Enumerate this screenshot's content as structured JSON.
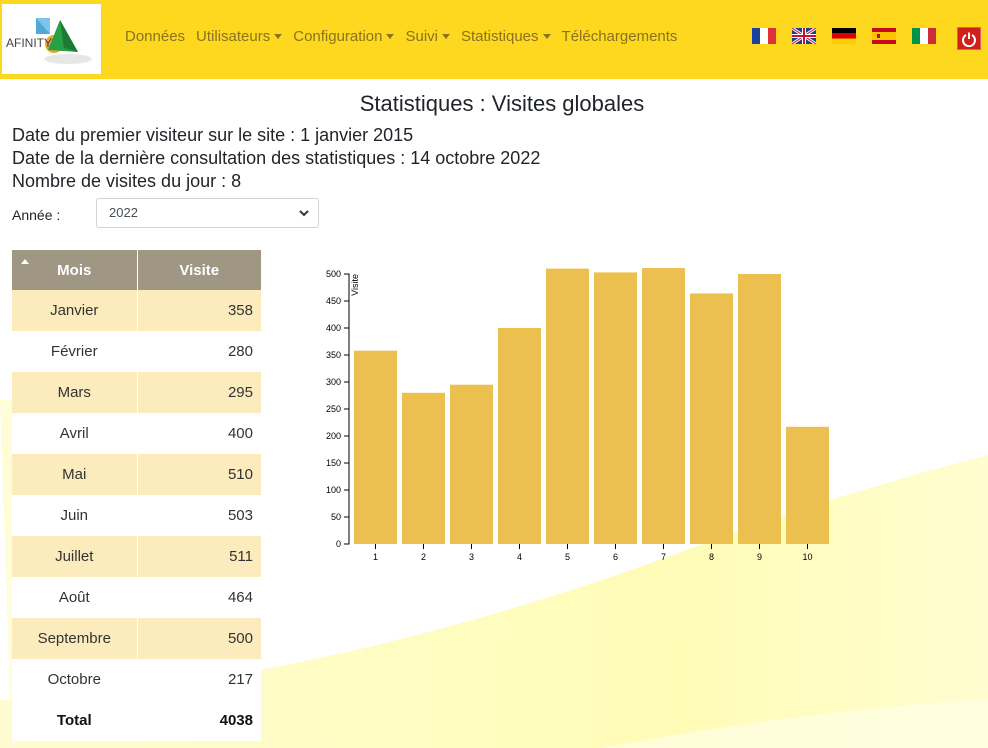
{
  "navbar": {
    "logo_text": "AFINITY",
    "items": [
      {
        "label": "Données",
        "dropdown": false
      },
      {
        "label": "Utilisateurs",
        "dropdown": true
      },
      {
        "label": "Configuration",
        "dropdown": true
      },
      {
        "label": "Suivi",
        "dropdown": true
      },
      {
        "label": "Statistiques",
        "dropdown": true
      },
      {
        "label": "Téléchargements",
        "dropdown": false
      }
    ],
    "flags": [
      "fr-flag-icon",
      "gb-flag-icon",
      "de-flag-icon",
      "es-flag-icon",
      "it-flag-icon"
    ],
    "logout_icon": "power-icon",
    "colors": {
      "navbar_bg": "#fdd81f",
      "nav_text": "#8a7220",
      "logout_bg": "#d0201c"
    }
  },
  "page": {
    "title": "Statistiques : Visites globales",
    "first_visit": "Date du premier visiteur sur le site : 1 janvier 2015",
    "last_consult": "Date de la dernière consultation des statistiques : 14 octobre 2022",
    "today_visits": "Nombre de visites du jour : 8",
    "year_label": "Année :",
    "year_value": "2022"
  },
  "table": {
    "headers": [
      "Mois",
      "Visite"
    ],
    "rows": [
      {
        "month": "Janvier",
        "visits": "358"
      },
      {
        "month": "Février",
        "visits": "280"
      },
      {
        "month": "Mars",
        "visits": "295"
      },
      {
        "month": "Avril",
        "visits": "400"
      },
      {
        "month": "Mai",
        "visits": "510"
      },
      {
        "month": "Juin",
        "visits": "503"
      },
      {
        "month": "Juillet",
        "visits": "511"
      },
      {
        "month": "Août",
        "visits": "464"
      },
      {
        "month": "Septembre",
        "visits": "500"
      },
      {
        "month": "Octobre",
        "visits": "217"
      }
    ],
    "total_label": "Total",
    "total_value": "4038",
    "colors": {
      "header_bg": "#a09684",
      "odd_row_bg": "#fcebbd"
    }
  },
  "chart_data": {
    "type": "bar",
    "categories": [
      "1",
      "2",
      "3",
      "4",
      "5",
      "6",
      "7",
      "8",
      "9",
      "10"
    ],
    "values": [
      358,
      280,
      295,
      400,
      510,
      503,
      511,
      464,
      500,
      217
    ],
    "title": "",
    "xlabel": "",
    "ylabel": "Visite",
    "ylim": [
      0,
      500
    ],
    "yticks": [
      0,
      50,
      100,
      150,
      200,
      250,
      300,
      350,
      400,
      450,
      500
    ],
    "grid": false,
    "bar_color": "#ecc04e"
  }
}
